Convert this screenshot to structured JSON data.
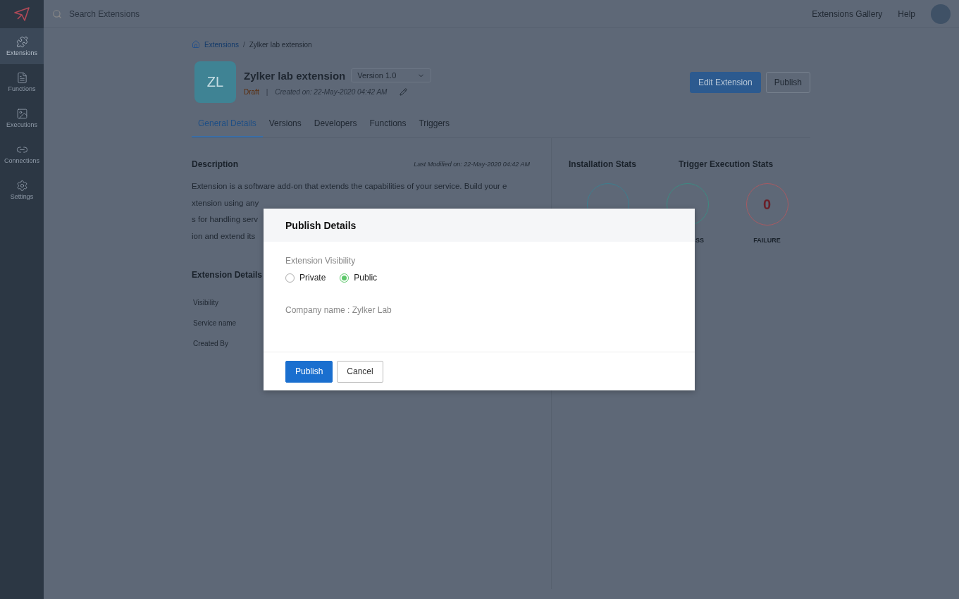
{
  "sidebar": {
    "items": [
      {
        "label": "Extensions",
        "kind": "extensions",
        "selected": true
      },
      {
        "label": "Functions",
        "kind": "functions",
        "selected": false
      },
      {
        "label": "Executions",
        "kind": "executions",
        "selected": false
      },
      {
        "label": "Connections",
        "kind": "connections",
        "selected": false
      },
      {
        "label": "Settings",
        "kind": "settings",
        "selected": false
      }
    ]
  },
  "topbar": {
    "search": {
      "placeholder": "Search Extensions"
    },
    "links": [
      "Extensions Gallery",
      "Help"
    ]
  },
  "breadcrumb": {
    "items": [
      "Extensions",
      "Zylker lab extension"
    ],
    "separator": "/"
  },
  "extension": {
    "initials": "ZL",
    "name": "Zylker lab extension",
    "version": "Version 1.0",
    "status": "Draft",
    "separator": "|",
    "created": "Created on: 22-May-2020 04:42 AM"
  },
  "actions": [
    {
      "label": "Edit Extension",
      "kind": "primary"
    },
    {
      "label": "Publish",
      "kind": "secondary"
    }
  ],
  "tabs": [
    {
      "label": "General Details",
      "selected": true
    },
    {
      "label": "Versions",
      "selected": false
    },
    {
      "label": "Developers",
      "selected": false
    },
    {
      "label": "Functions",
      "selected": false
    },
    {
      "label": "Triggers",
      "selected": false
    }
  ],
  "description": {
    "title": "Description",
    "modified": "Last Modified on: 22-May-2020 04:42 AM",
    "lines": [
      "Extension is a software add-on that extends the capabilities of your service. Build your e",
      "xtension using any",
      "s for handling serv",
      "ion and extend its"
    ]
  },
  "details": {
    "title": "Extension Details",
    "rows": [
      "Visibility",
      "Service name",
      "Created By"
    ]
  },
  "stats": {
    "titles": [
      "Installation Stats",
      "Trigger Execution Stats"
    ],
    "circles": [
      {
        "kind": "installation",
        "color": "#3d7f8f"
      },
      {
        "kind": "success",
        "label": "SS",
        "color": "#3d8a82"
      },
      {
        "kind": "failure",
        "value": "0",
        "label": "FAILURE",
        "color": "#a85a62"
      }
    ]
  },
  "dialog": {
    "title": "Publish Details",
    "field_label": "Extension Visibility",
    "options": [
      {
        "label": "Private",
        "selected": false
      },
      {
        "label": "Public",
        "selected": true
      }
    ],
    "company": "Company name : Zylker Lab",
    "buttons": [
      {
        "label": "Publish",
        "kind": "primary"
      },
      {
        "label": "Cancel",
        "kind": "secondary"
      }
    ]
  }
}
